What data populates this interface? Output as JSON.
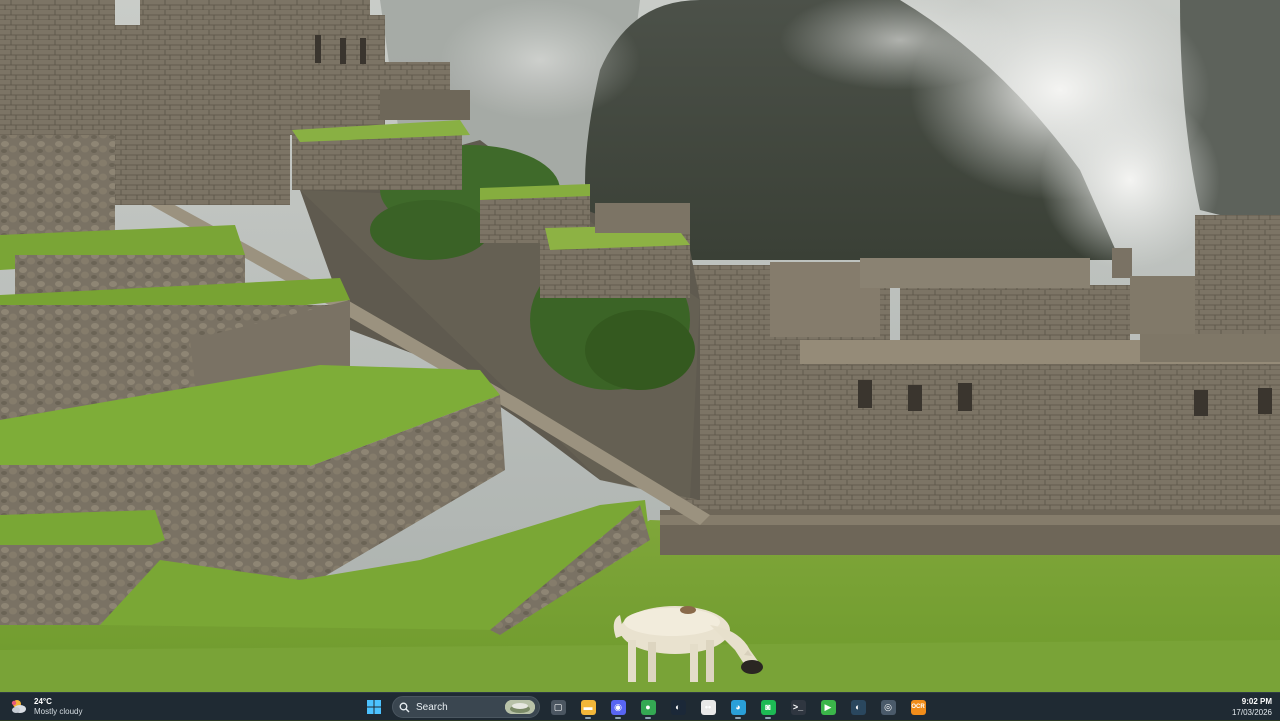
{
  "desktop": {
    "wallpaper": "machu-picchu-llama"
  },
  "taskbar": {
    "background": "#1f2a33",
    "weather": {
      "temperature": "24°C",
      "condition": "Mostly cloudy",
      "icon": "cloud-sun-icon"
    },
    "start": {
      "icon": "windows-start-icon"
    },
    "search": {
      "label": "Search",
      "icon": "search-icon"
    },
    "pinned_apps": [
      {
        "name": "task-view-icon",
        "symbol": "▢",
        "color": "#4b5661",
        "active": false
      },
      {
        "name": "file-explorer-icon",
        "symbol": "▬",
        "color": "#f2b63a",
        "active": true
      },
      {
        "name": "discord-icon",
        "symbol": "◉",
        "color": "#5865f2",
        "active": true
      },
      {
        "name": "chrome-icon",
        "symbol": "●",
        "color": "#34a853",
        "active": true
      },
      {
        "name": "steam-icon",
        "symbol": "◐",
        "color": "#1b2838",
        "active": false
      },
      {
        "name": "chat-app-icon",
        "symbol": "••",
        "color": "#e8e8e8",
        "active": false
      },
      {
        "name": "edge-icon",
        "symbol": "◕",
        "color": "#2a9fd8",
        "active": true
      },
      {
        "name": "spotify-icon",
        "symbol": "◙",
        "color": "#1db954",
        "active": true
      },
      {
        "name": "terminal-icon",
        "symbol": ">_",
        "color": "#2f3640",
        "active": false
      },
      {
        "name": "media-player-icon",
        "symbol": "▶",
        "color": "#3bb54a",
        "active": false
      },
      {
        "name": "steam-client-icon",
        "symbol": "◐",
        "color": "#2a475e",
        "active": false
      },
      {
        "name": "tool-app-icon",
        "symbol": "◎",
        "color": "#4a5a6a",
        "active": false
      },
      {
        "name": "orange-app-icon",
        "symbol": "OCR",
        "color": "#f08c1a",
        "active": false
      }
    ],
    "clock": {
      "time": "9:02 PM",
      "date": "17/03/2026"
    }
  }
}
